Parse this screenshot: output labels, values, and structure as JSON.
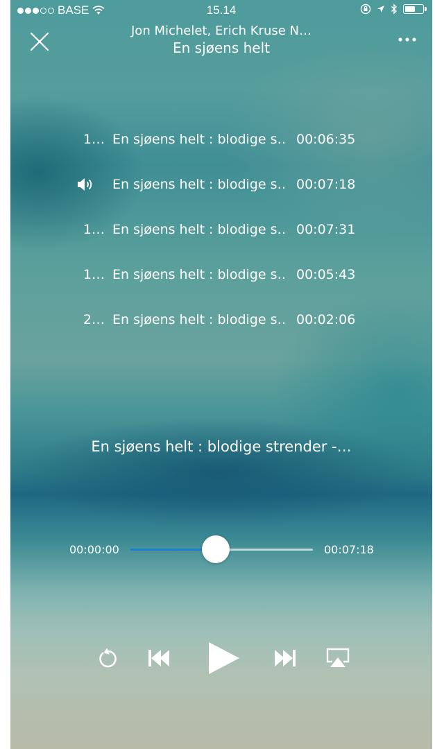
{
  "status_bar": {
    "carrier": "BASE",
    "time": "15.14",
    "battery_percent": 60,
    "signal_bars_filled": 3,
    "signal_bars_total": 5
  },
  "header": {
    "subtitle": "Jon Michelet, Erich Kruse N…",
    "title": "En sjøens helt",
    "close_icon": "close-icon",
    "more_icon": "more-icon"
  },
  "tracks": [
    {
      "number": "1…",
      "title": "En sjøens helt : blodige s…",
      "duration": "00:06:35",
      "playing": false
    },
    {
      "number": "",
      "title": "En sjøens helt : blodige s…",
      "duration": "00:07:18",
      "playing": true
    },
    {
      "number": "1…",
      "title": "En sjøens helt : blodige s…",
      "duration": "00:07:31",
      "playing": false
    },
    {
      "number": "1…",
      "title": "En sjøens helt : blodige s…",
      "duration": "00:05:43",
      "playing": false
    },
    {
      "number": "2…",
      "title": "En sjøens helt : blodige s…",
      "duration": "00:02:06",
      "playing": false
    }
  ],
  "now_playing": {
    "title": "En sjøens helt : blodige strender -…",
    "elapsed": "00:00:00",
    "total": "00:07:18",
    "progress_fraction": 0.47
  },
  "controls": {
    "replay": "replay-icon",
    "previous": "previous-icon",
    "play": "play-icon",
    "next": "next-icon",
    "airplay": "airplay-icon"
  },
  "colors": {
    "accent": "#1e7ed6",
    "text": "#ffffff"
  }
}
